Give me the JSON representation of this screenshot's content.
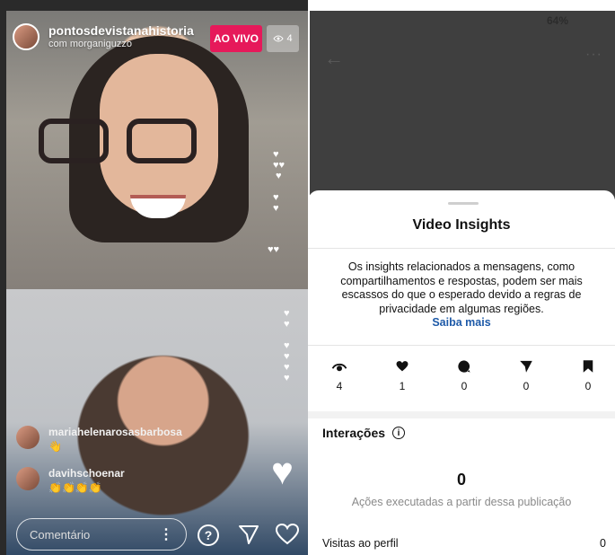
{
  "live": {
    "host_username": "pontosdevistanahistoria",
    "host_subtitle": "com morganiguzzo",
    "live_badge": "AO VIVO",
    "viewer_count": "4",
    "comments": [
      {
        "username": "mariahelenarosasbarbosa",
        "text": "👋"
      },
      {
        "username": "davihschoenar",
        "text": "👏👏👏👏"
      }
    ],
    "comment_placeholder": "Comentário",
    "icons": [
      "eye-icon",
      "question-icon",
      "send-icon",
      "heart-icon",
      "more-icon"
    ]
  },
  "insights": {
    "status_text": "64%",
    "title": "Video Insights",
    "notice": "Os insights relacionados a mensagens, como compartilhamentos e respostas, podem ser mais escassos do que o esperado devido a regras de privacidade em algumas regiões.",
    "notice_link": "Saiba mais",
    "stats": [
      {
        "icon": "eye-icon",
        "value": "4"
      },
      {
        "icon": "heart-icon",
        "value": "1"
      },
      {
        "icon": "comment-icon",
        "value": "0"
      },
      {
        "icon": "send-icon",
        "value": "0"
      },
      {
        "icon": "bookmark-icon",
        "value": "0"
      }
    ],
    "interactions_label": "Interações",
    "interactions_value": "0",
    "interactions_caption": "Ações executadas a partir dessa publicação",
    "profile_visits_label": "Visitas ao perfil",
    "profile_visits_value": "0"
  }
}
